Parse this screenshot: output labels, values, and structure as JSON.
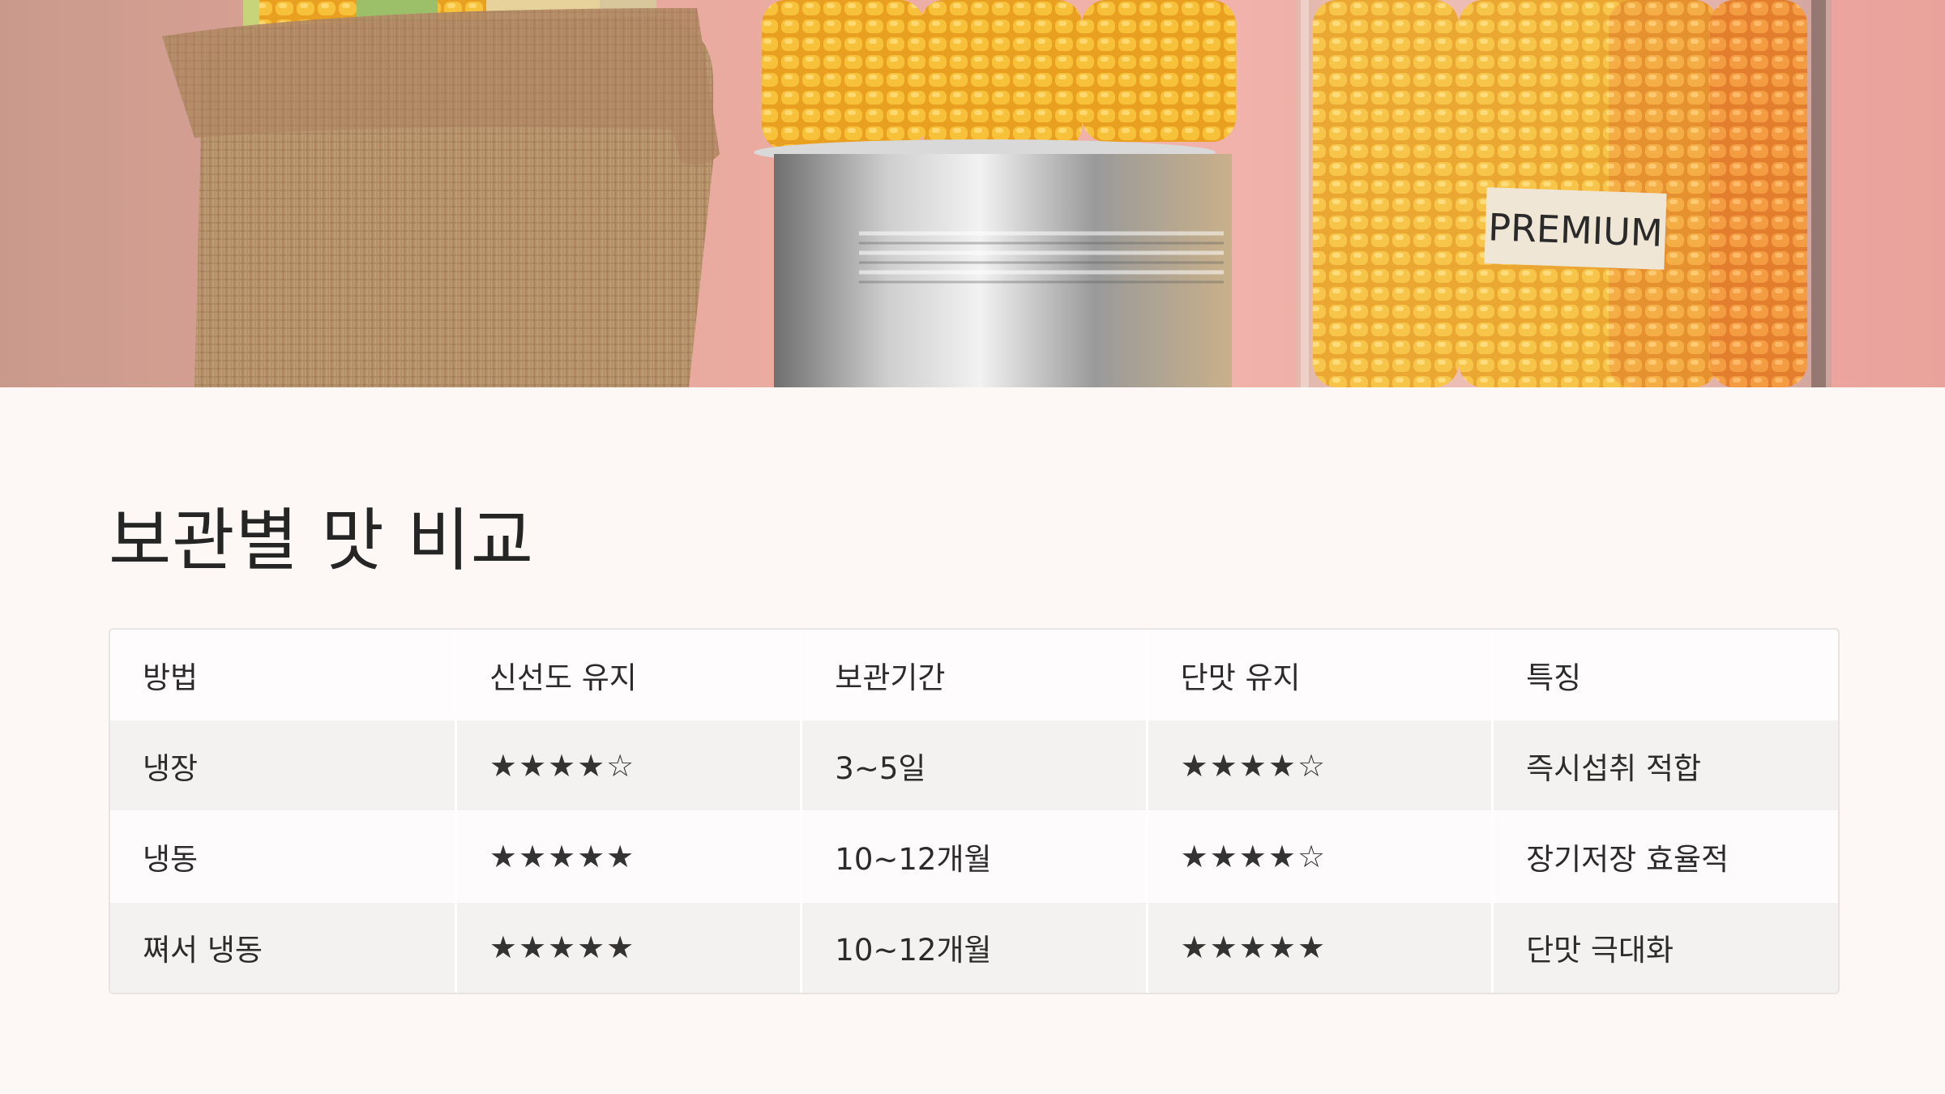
{
  "hero": {
    "label_text": "PREMIUM"
  },
  "title": "보관별 맛 비교",
  "table": {
    "headers": [
      "방법",
      "신선도 유지",
      "보관기간",
      "단맛 유지",
      "특징"
    ],
    "rows": [
      [
        "냉장",
        "★★★★☆",
        "3~5일",
        "★★★★☆",
        "즉시섭취 적합"
      ],
      [
        "냉동",
        "★★★★★",
        "10~12개월",
        "★★★★☆",
        "장기저장 효율적"
      ],
      [
        "쪄서 냉동",
        "★★★★★",
        "10~12개월",
        "★★★★★",
        "단맛 극대화"
      ]
    ]
  }
}
